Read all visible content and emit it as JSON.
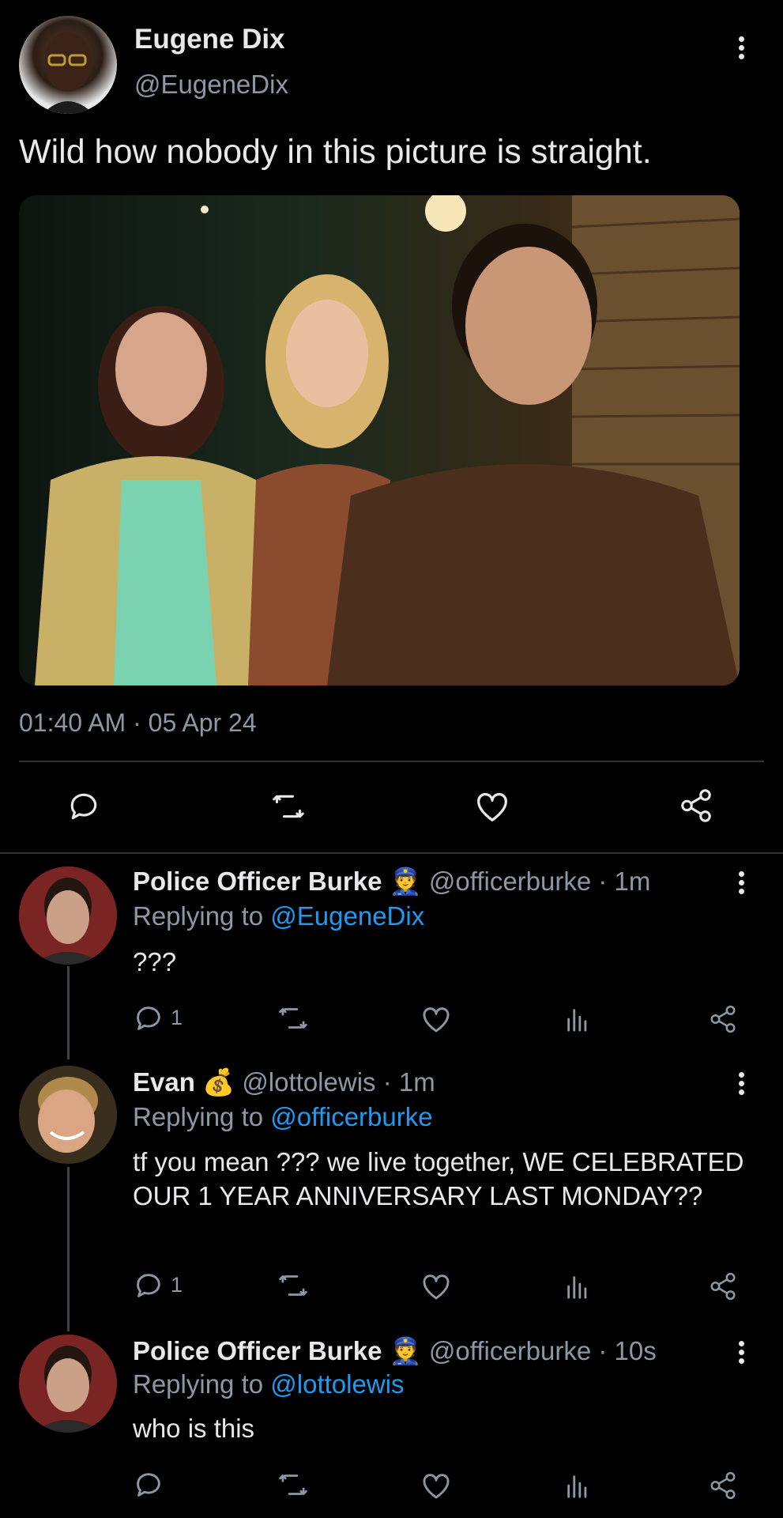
{
  "main_tweet": {
    "author_name": "Eugene Dix",
    "author_handle": "@EugeneDix",
    "text": "Wild how nobody in this picture is straight.",
    "timestamp": "01:40 AM · 05 Apr 24",
    "image_alt": "Three people standing at night beside a wooden house",
    "icons": [
      "reply-icon",
      "retweet-icon",
      "like-icon",
      "share-icon"
    ]
  },
  "replies": [
    {
      "author_name": "Police Officer Burke",
      "emoji": "👮",
      "handle_time": "@officerburke · 1m",
      "replying_prefix": "Replying to",
      "replying_to": "@EugeneDix",
      "text": "???",
      "reply_count": "1"
    },
    {
      "author_name": "Evan",
      "emoji": "💰",
      "handle_time": "@lottolewis · 1m",
      "replying_prefix": "Replying to",
      "replying_to": "@officerburke",
      "text": "tf you mean ??? we live together, WE CELEBRATED OUR 1 YEAR ANNIVERSARY LAST MONDAY??",
      "reply_count": "1"
    },
    {
      "author_name": "Police Officer Burke",
      "emoji": "👮",
      "handle_time": "@officerburke · 10s",
      "replying_prefix": "Replying to",
      "replying_to": "@lottolewis",
      "text": "who is this",
      "reply_count": ""
    }
  ],
  "colors": {
    "background": "#000000",
    "text": "#e7e9ea",
    "muted": "#8b98a5",
    "link": "#1d9bf0",
    "divider": "#2f3336"
  }
}
